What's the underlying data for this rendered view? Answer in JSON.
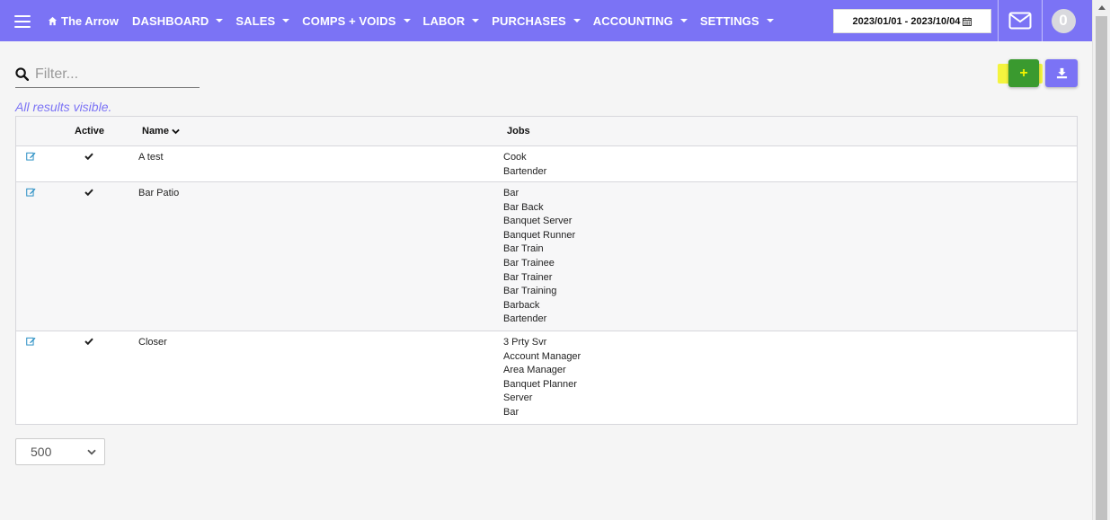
{
  "app": {
    "brand": "The Arrow"
  },
  "nav": {
    "items": [
      {
        "label": "DASHBOARD"
      },
      {
        "label": "SALES"
      },
      {
        "label": "COMPS + VOIDS"
      },
      {
        "label": "LABOR"
      },
      {
        "label": "PURCHASES"
      },
      {
        "label": "ACCOUNTING"
      },
      {
        "label": "SETTINGS"
      }
    ],
    "date_range": "2023/01/01 - 2023/10/04",
    "notification_count": "0"
  },
  "icons": {
    "menu": "hamburger-icon",
    "brand": "home-icon",
    "date": "calendar-icon",
    "mail": "envelope-icon",
    "filter": "search-icon",
    "add": "plus-icon",
    "download": "download-icon",
    "edit": "edit-icon",
    "active": "check-icon",
    "sort": "chevron-down-icon"
  },
  "filter": {
    "placeholder": "Filter...",
    "value": ""
  },
  "results_note": "All results visible.",
  "actions": {
    "add_label": "+"
  },
  "table": {
    "headers": {
      "active": "Active",
      "name": "Name",
      "jobs": "Jobs"
    },
    "rows": [
      {
        "active": true,
        "name": "A test",
        "jobs": [
          "Cook",
          "Bartender"
        ]
      },
      {
        "active": true,
        "name": "Bar Patio",
        "jobs": [
          "Bar",
          "Bar Back",
          "Banquet Server",
          "Banquet Runner",
          "Bar Train",
          "Bar Trainee",
          "Bar Trainer",
          "Bar Training",
          "Barback",
          "Bartender"
        ]
      },
      {
        "active": true,
        "name": "Closer",
        "jobs": [
          "3 Prty Svr",
          "Account Manager",
          "Area Manager",
          "Banquet Planner",
          "Server",
          "Bar"
        ]
      }
    ]
  },
  "pagination": {
    "page_size": "500"
  },
  "colors": {
    "primary": "#7b73f5",
    "add_button": "#3a9a2f",
    "highlight": "#f3f300",
    "edit_icon": "#2a8fc4"
  }
}
